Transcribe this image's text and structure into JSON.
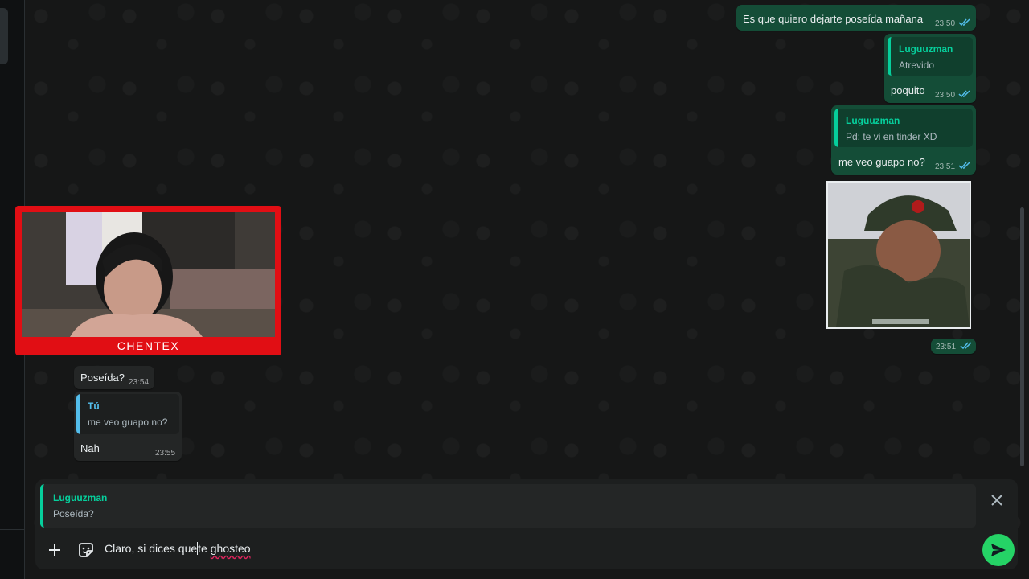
{
  "chat": {
    "outgoing": [
      {
        "text": "Es que quiero dejarte poseída mañana",
        "time": "23:50"
      },
      {
        "reply_author": "Luguuzman",
        "reply_text": "Atrevido",
        "text": "poquito",
        "time": "23:50"
      },
      {
        "reply_author": "Luguuzman",
        "reply_text": "Pd: te vi en tinder XD",
        "text": "me veo guapo no?",
        "time": "23:51"
      },
      {
        "type": "image",
        "time": "23:51"
      }
    ],
    "incoming": [
      {
        "text": "Poseída?",
        "time": "23:54"
      },
      {
        "reply_author": "Tú",
        "reply_text": "me veo guapo no?",
        "text": "Nah",
        "time": "23:55"
      }
    ]
  },
  "webcam": {
    "name": "CHENTEX"
  },
  "composer": {
    "reply_author": "Luguuzman",
    "reply_text": "Poseída?",
    "input_before_caret": "Claro, si dices que",
    "input_after_caret": "te",
    "input_misspelled": "ghosteo"
  },
  "icons": [
    "plus-icon",
    "sticker-icon",
    "close-icon",
    "send-icon",
    "double-check-icon"
  ],
  "colors": {
    "accent": "#25d366",
    "outgoing_bubble": "#144d37",
    "incoming_bubble": "#242626",
    "read_ticks": "#53bdeb",
    "cam_frame": "#e10e14"
  }
}
